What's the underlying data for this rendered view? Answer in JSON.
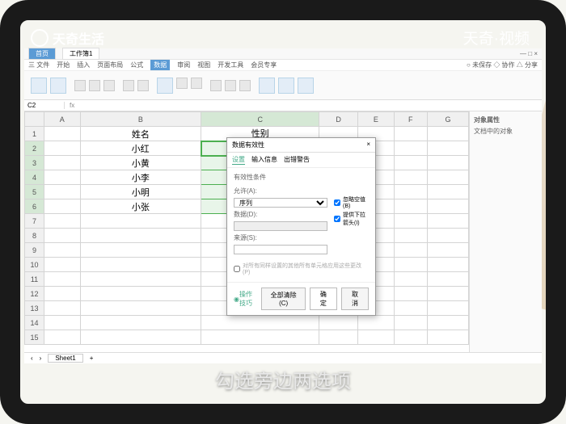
{
  "branding": {
    "top_left": "天奇生活",
    "top_right": "天奇·视频",
    "caption": "勾选旁边两选项"
  },
  "titlebar": {
    "tab1": "首页",
    "tab2": "工作簿1",
    "win_controls": "— □ ×"
  },
  "menubar": {
    "items": [
      "三 文件",
      "开始",
      "插入",
      "页面布局",
      "公式",
      "数据",
      "审阅",
      "视图",
      "开发工具",
      "会员专享"
    ],
    "active_index": 5,
    "right": "○ 未保存  ◇ 协作  △ 分享"
  },
  "formula_bar": {
    "name_box": "C2",
    "fx": "fx"
  },
  "columns": [
    "A",
    "B",
    "C",
    "D",
    "E",
    "F",
    "G"
  ],
  "rows_count": 15,
  "data": {
    "B1": "姓名",
    "C1": "性别",
    "B2": "小红",
    "B3": "小黄",
    "B4": "小李",
    "B5": "小明",
    "B6": "小张"
  },
  "selection": {
    "col": "C",
    "rows": [
      2,
      3,
      4,
      5,
      6
    ]
  },
  "sidebar": {
    "title": "对象属性",
    "sub": "文档中的对象"
  },
  "dialog": {
    "title": "数据有效性",
    "tabs": [
      "设置",
      "输入信息",
      "出错警告"
    ],
    "active_tab": 0,
    "section_label": "有效性条件",
    "allow_label": "允许(A):",
    "allow_value": "序列",
    "data_label": "数据(D):",
    "source_label": "来源(S):",
    "check1": "忽略空值(B)",
    "check2": "提供下拉箭头(I)",
    "apply_all": "对所有同样设置的其他所有单元格应用这些更改(P)",
    "help_link": "操作技巧",
    "btn_clear": "全部清除(C)",
    "btn_ok": "确定",
    "btn_cancel": "取消"
  },
  "sheet_tab": "Sheet1"
}
